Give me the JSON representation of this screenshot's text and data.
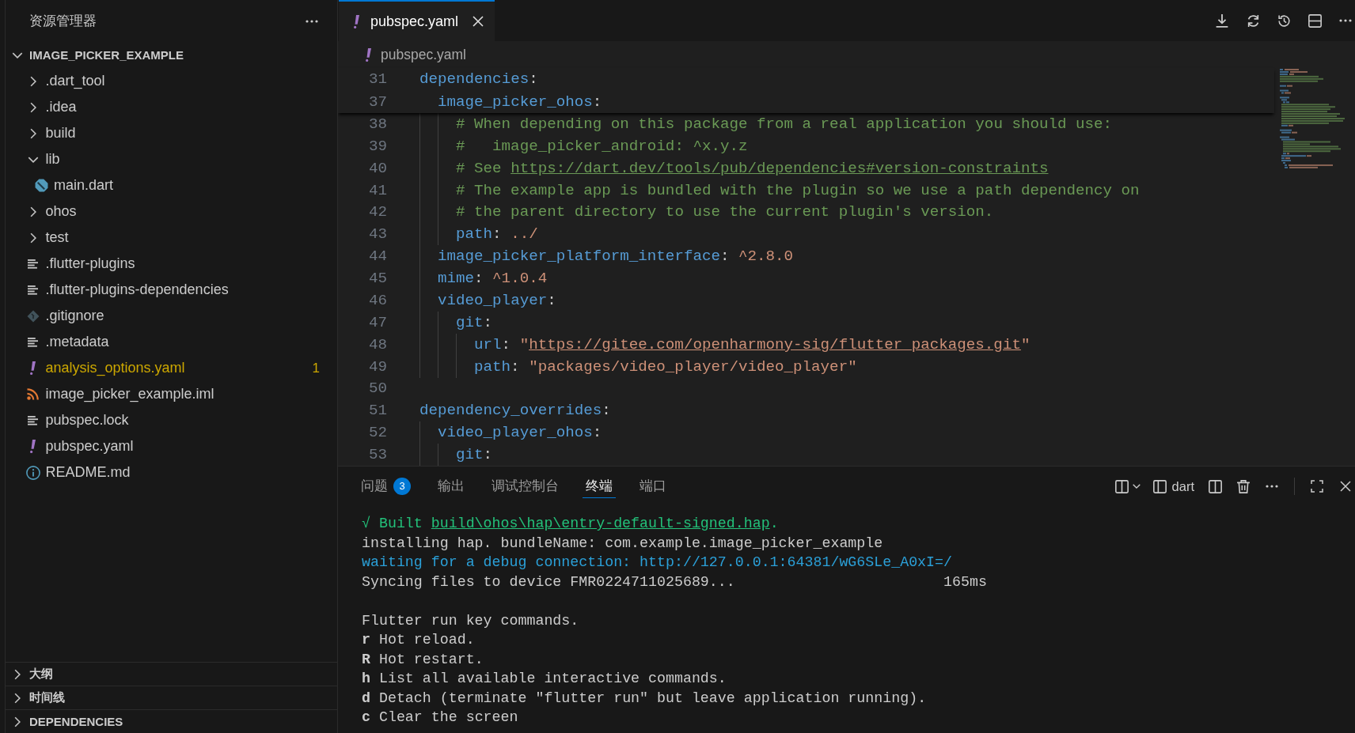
{
  "explorer": {
    "title": "资源管理器",
    "root": {
      "label": "IMAGE_PICKER_EXAMPLE",
      "expanded": true,
      "warning": false,
      "children": [
        {
          "label": ".dart_tool",
          "kind": "folder",
          "expanded": false,
          "warning": false
        },
        {
          "label": ".idea",
          "kind": "folder",
          "expanded": false,
          "warning": false
        },
        {
          "label": "build",
          "kind": "folder",
          "expanded": false,
          "warning": false
        },
        {
          "label": "lib",
          "kind": "folder",
          "expanded": true,
          "warning": false,
          "children": [
            {
              "label": "main.dart",
              "kind": "dart",
              "warning": false
            }
          ]
        },
        {
          "label": "ohos",
          "kind": "folder",
          "expanded": false,
          "warning": false
        },
        {
          "label": "test",
          "kind": "folder",
          "expanded": false,
          "warning": false
        },
        {
          "label": ".flutter-plugins",
          "kind": "text",
          "warning": false
        },
        {
          "label": ".flutter-plugins-dependencies",
          "kind": "text",
          "warning": false
        },
        {
          "label": ".gitignore",
          "kind": "git",
          "warning": false
        },
        {
          "label": ".metadata",
          "kind": "text",
          "warning": false
        },
        {
          "label": "analysis_options.yaml",
          "kind": "yaml",
          "warning": true,
          "problems": "1"
        },
        {
          "label": "image_picker_example.iml",
          "kind": "xml",
          "warning": false
        },
        {
          "label": "pubspec.lock",
          "kind": "text",
          "warning": false
        },
        {
          "label": "pubspec.yaml",
          "kind": "yaml",
          "warning": false
        },
        {
          "label": "README.md",
          "kind": "readme",
          "warning": false
        }
      ]
    },
    "sections": [
      {
        "label": "大纲",
        "expanded": false
      },
      {
        "label": "时间线",
        "expanded": false
      },
      {
        "label": "DEPENDENCIES",
        "expanded": false
      }
    ]
  },
  "editor": {
    "tabs": [
      {
        "label": "pubspec.yaml",
        "kind": "yaml",
        "selected": true
      }
    ],
    "breadcrumb": {
      "label": "pubspec.yaml",
      "kind": "yaml"
    },
    "sticky_lines": [
      {
        "number": "31",
        "tokens": [
          {
            "kind": "key",
            "text": "dependencies"
          },
          {
            "kind": "punct",
            "text": ":"
          }
        ],
        "children": [
          {
            "number": "37",
            "tokens": [
              {
                "kind": "key",
                "text": "image_picker_ohos"
              },
              {
                "kind": "punct",
                "text": ":"
              }
            ]
          }
        ]
      }
    ],
    "lines": [
      {
        "children": [
          {
            "children": [
              {
                "number": "38",
                "tokens": [
                  {
                    "kind": "comment",
                    "text": "# When depending on this package from a real application you should use:"
                  }
                ]
              },
              {
                "number": "39",
                "tokens": [
                  {
                    "kind": "comment",
                    "text": "#   image_picker_android: ^x.y.z"
                  }
                ]
              },
              {
                "number": "40",
                "tokens": [
                  {
                    "kind": "comment",
                    "text": "# See "
                  },
                  {
                    "kind": "link",
                    "text": "https://dart.dev/tools/pub/dependencies#version-constraints"
                  }
                ]
              },
              {
                "number": "41",
                "tokens": [
                  {
                    "kind": "comment",
                    "text": "# The example app is bundled with the plugin so we use a path dependency on"
                  }
                ]
              },
              {
                "number": "42",
                "tokens": [
                  {
                    "kind": "comment",
                    "text": "# the parent directory to use the current plugin's version."
                  }
                ]
              },
              {
                "number": "43",
                "tokens": [
                  {
                    "kind": "key",
                    "text": "path"
                  },
                  {
                    "kind": "punct",
                    "text": ": "
                  },
                  {
                    "kind": "string",
                    "text": "../"
                  }
                ]
              }
            ]
          },
          {
            "number": "44",
            "tokens": [
              {
                "kind": "key",
                "text": "image_picker_platform_interface"
              },
              {
                "kind": "punct",
                "text": ": "
              },
              {
                "kind": "string",
                "text": "^2.8.0"
              }
            ]
          },
          {
            "number": "45",
            "tokens": [
              {
                "kind": "key",
                "text": "mime"
              },
              {
                "kind": "punct",
                "text": ": "
              },
              {
                "kind": "string",
                "text": "^1.0.4"
              }
            ]
          },
          {
            "number": "46",
            "tokens": [
              {
                "kind": "key",
                "text": "video_player"
              },
              {
                "kind": "punct",
                "text": ":"
              }
            ],
            "children": [
              {
                "number": "47",
                "tokens": [
                  {
                    "kind": "key",
                    "text": "git"
                  },
                  {
                    "kind": "punct",
                    "text": ":"
                  }
                ],
                "children": [
                  {
                    "number": "48",
                    "tokens": [
                      {
                        "kind": "key",
                        "text": "url"
                      },
                      {
                        "kind": "punct",
                        "text": ": "
                      },
                      {
                        "kind": "string",
                        "text": "\""
                      },
                      {
                        "kind": "url",
                        "text": "https://gitee.com/openharmony-sig/flutter_packages.git"
                      },
                      {
                        "kind": "string",
                        "text": "\""
                      }
                    ]
                  },
                  {
                    "number": "49",
                    "tokens": [
                      {
                        "kind": "key",
                        "text": "path"
                      },
                      {
                        "kind": "punct",
                        "text": ": "
                      },
                      {
                        "kind": "string",
                        "text": "\"packages/video_player/video_player\""
                      }
                    ]
                  }
                ]
              }
            ]
          }
        ]
      },
      {
        "number": "50"
      },
      {
        "number": "51",
        "tokens": [
          {
            "kind": "key",
            "text": "dependency_overrides"
          },
          {
            "kind": "punct",
            "text": ":"
          }
        ],
        "children": [
          {
            "number": "52",
            "tokens": [
              {
                "kind": "key",
                "text": "video_player_ohos"
              },
              {
                "kind": "punct",
                "text": ":"
              }
            ],
            "children": [
              {
                "number": "53",
                "tokens": [
                  {
                    "kind": "key",
                    "text": "git"
                  },
                  {
                    "kind": "punct",
                    "text": ":"
                  }
                ]
              }
            ]
          }
        ]
      }
    ]
  },
  "panel": {
    "tabs": [
      {
        "label": "问题",
        "badge": "3",
        "selected": false
      },
      {
        "label": "输出",
        "selected": false
      },
      {
        "label": "调试控制台",
        "selected": false
      },
      {
        "label": "终端",
        "selected": true
      },
      {
        "label": "端口",
        "selected": false
      }
    ],
    "terminal_name": "dart",
    "terminal": [
      {
        "kind": "success",
        "text": "√ Built",
        "link": "build\\ohos\\hap\\entry-default-signed.hap",
        "tail": "."
      },
      {
        "kind": "plain",
        "text": "installing hap. bundleName: com.example.image_picker_example"
      },
      {
        "kind": "info",
        "text": "waiting for a debug connection: http://127.0.0.1:64381/wG6SLe_A0xI=/"
      },
      {
        "kind": "timed",
        "text": "Syncing files to device FMR0224711025689...",
        "time": "165ms"
      },
      {
        "kind": "blank"
      },
      {
        "kind": "plain",
        "text": "Flutter run key commands."
      },
      {
        "kind": "plain",
        "text": "**r** Hot reload."
      },
      {
        "kind": "plain",
        "text": "**R** Hot restart."
      },
      {
        "kind": "plain",
        "text": "**h** List all available interactive commands."
      },
      {
        "kind": "plain",
        "text": "**d** Detach (terminate \"flutter run\" but leave application running)."
      },
      {
        "kind": "plain",
        "text": "**c** Clear the screen"
      }
    ]
  }
}
